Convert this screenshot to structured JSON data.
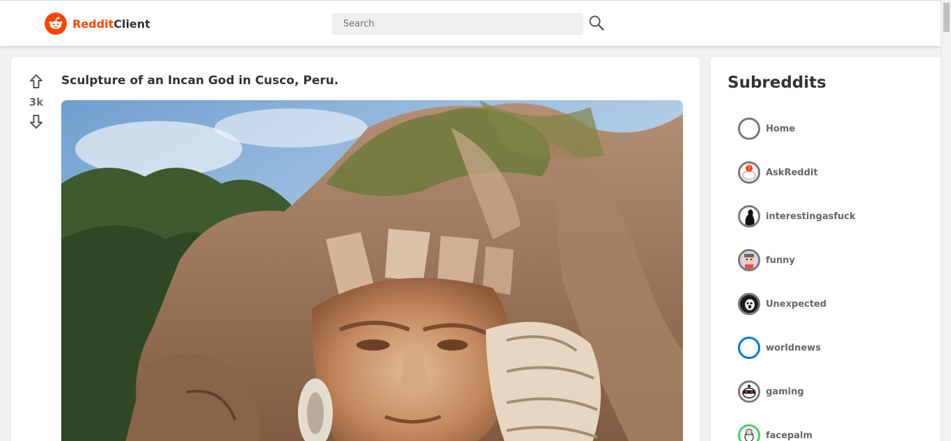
{
  "header": {
    "logo_brand": "Reddit",
    "logo_rest": "Client",
    "search_placeholder": "Search"
  },
  "post": {
    "title": "Sculpture of an Incan God in Cusco, Peru.",
    "votes": "3k"
  },
  "sidebar": {
    "title": "Subreddits",
    "items": [
      {
        "label": "Home",
        "icon": "empty-circle-icon",
        "ring": "#777777"
      },
      {
        "label": "AskReddit",
        "icon": "askreddit-icon",
        "ring": "#777777"
      },
      {
        "label": "interestingasfuck",
        "icon": "interestingasfuck-icon",
        "ring": "#777777"
      },
      {
        "label": "funny",
        "icon": "funny-icon",
        "ring": "#777777"
      },
      {
        "label": "Unexpected",
        "icon": "unexpected-icon",
        "ring": "#777777"
      },
      {
        "label": "worldnews",
        "icon": "worldnews-icon",
        "ring": "#0079d3"
      },
      {
        "label": "gaming",
        "icon": "gaming-icon",
        "ring": "#777777"
      },
      {
        "label": "facepalm",
        "icon": "facepalm-icon",
        "ring": "#46d160"
      }
    ]
  },
  "colors": {
    "accent": "#ff4500",
    "text": "#333333",
    "muted": "#6b6b6b"
  }
}
